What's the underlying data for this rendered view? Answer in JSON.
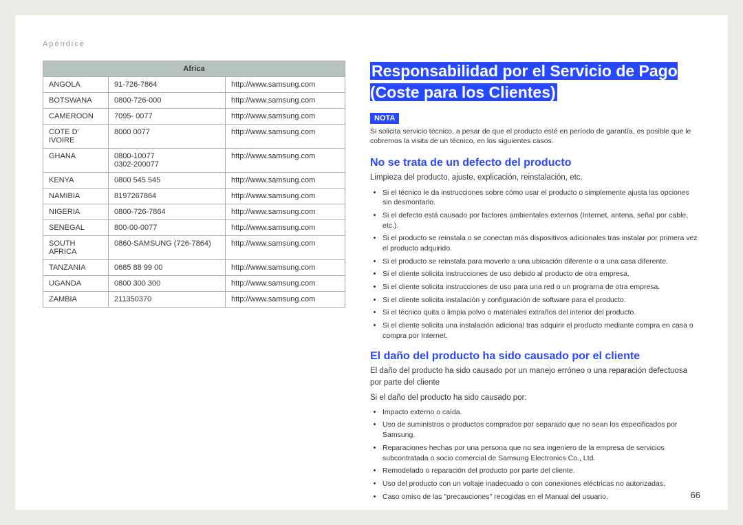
{
  "header": {
    "section": "Apéndice"
  },
  "table": {
    "header": "Africa",
    "rows": [
      {
        "country": "ANGOLA",
        "phone": "91-726-7864",
        "url": "http://www.samsung.com"
      },
      {
        "country": "BOTSWANA",
        "phone": "0800-726-000",
        "url": "http://www.samsung.com"
      },
      {
        "country": "CAMEROON",
        "phone": "7095- 0077",
        "url": "http://www.samsung.com"
      },
      {
        "country": "COTE D' IVOIRE",
        "phone": "8000 0077",
        "url": "http://www.samsung.com"
      },
      {
        "country": "GHANA",
        "phone": "0800-10077\n0302-200077",
        "url": "http://www.samsung.com"
      },
      {
        "country": "KENYA",
        "phone": "0800 545 545",
        "url": "http://www.samsung.com"
      },
      {
        "country": "NAMIBIA",
        "phone": "8197267864",
        "url": "http://www.samsung.com"
      },
      {
        "country": "NIGERIA",
        "phone": "0800-726-7864",
        "url": "http://www.samsung.com"
      },
      {
        "country": "SENEGAL",
        "phone": "800-00-0077",
        "url": "http://www.samsung.com"
      },
      {
        "country": "SOUTH AFRICA",
        "phone": "0860-SAMSUNG (726-7864)",
        "url": "http://www.samsung.com"
      },
      {
        "country": "TANZANIA",
        "phone": "0685 88 99 00",
        "url": "http://www.samsung.com"
      },
      {
        "country": "UGANDA",
        "phone": "0800 300 300",
        "url": "http://www.samsung.com"
      },
      {
        "country": "ZAMBIA",
        "phone": "211350370",
        "url": "http://www.samsung.com"
      }
    ]
  },
  "right": {
    "title": "Responsabilidad por el Servicio de Pago (Coste para los Clientes)",
    "nota_label": "NOTA",
    "nota_text": "Si solicita servicio técnico, a pesar de que el producto esté en período de garantía, es posible que le cobremos la visita de un técnico, en los siguientes casos.",
    "sec1": {
      "heading": "No se trata de un defecto del producto",
      "intro": "Limpieza del producto, ajuste, explicación, reinstalación, etc.",
      "items": [
        "Si el técnico le da instrucciones sobre cómo usar el producto o simplemente ajusta las opciones sin desmontarlo.",
        "Si el defecto está causado por factores ambientales externos (Internet, antena, señal por cable, etc.).",
        "Si el producto se reinstala o se conectan más dispositivos adicionales tras instalar por primera vez el producto adquirido.",
        "Si el producto se reinstala para moverlo a una ubicación diferente o a una casa diferente.",
        "Si el cliente solicita instrucciones de uso debido al producto de otra empresa.",
        "Si el cliente solicita instrucciones de uso para una red o un programa de otra empresa.",
        "Si el cliente solicita instalación y configuración de software para el producto.",
        "Si el técnico quita o limpia polvo o materiales extraños del interior del producto.",
        "Si el cliente solicita una instalación adicional tras adquirir el producto mediante compra en casa o compra por Internet."
      ]
    },
    "sec2": {
      "heading": "El daño del producto ha sido causado por el cliente",
      "intro1": "El daño del producto ha sido causado por un manejo erróneo o una reparación defectuosa por parte del cliente",
      "intro2": "Si el daño del producto ha sido causado por:",
      "items": [
        "Impacto externo o caída.",
        "Uso de suministros o productos comprados por separado que no sean los especificados por Samsung.",
        "Reparaciones hechas por una persona que no sea ingeniero de la empresa de servicios subcontratada o socio comercial de Samsung Electronics Co., Ltd.",
        "Remodelado o reparación del producto por parte del cliente.",
        "Uso del producto con un voltaje inadecuado o con conexiones eléctricas no autorizadas.",
        "Caso omiso de las \"precauciones\" recogidas en el Manual del usuario."
      ]
    }
  },
  "page_number": "66"
}
